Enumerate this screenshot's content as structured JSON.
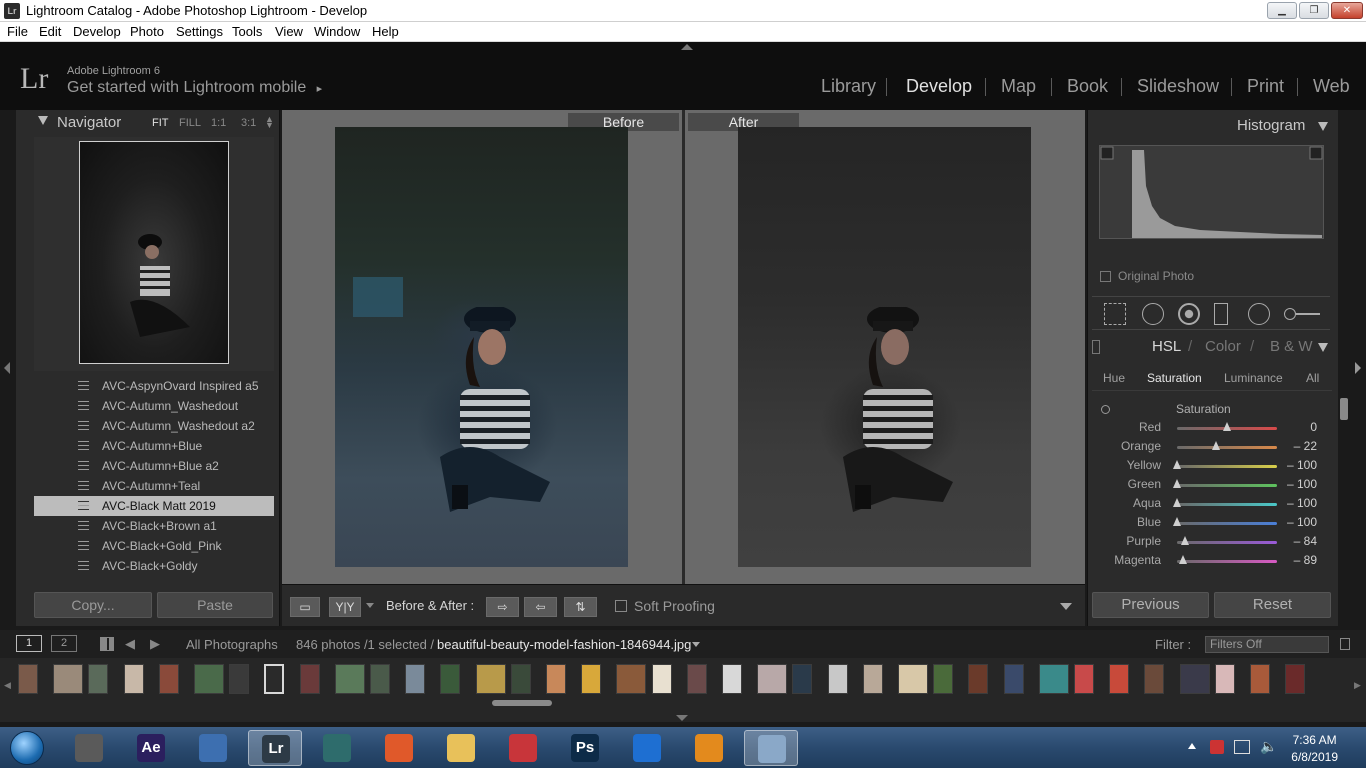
{
  "window": {
    "title": "Lightroom Catalog - Adobe Photoshop Lightroom - Develop",
    "app_icon": "Lr",
    "controls": [
      "minimize-icon",
      "maximize-icon",
      "close-icon"
    ]
  },
  "menu": [
    "File",
    "Edit",
    "Develop",
    "Photo",
    "Settings",
    "Tools",
    "View",
    "Window",
    "Help"
  ],
  "header": {
    "logo": "Lr",
    "version": "Adobe Lightroom 6",
    "mobile_prompt": "Get started with Lightroom mobile",
    "mobile_arrow": "▸",
    "modules": [
      "Library",
      "Develop",
      "Map",
      "Book",
      "Slideshow",
      "Print",
      "Web"
    ],
    "active_module": "Develop"
  },
  "navigator": {
    "title": "Navigator",
    "zoom_options": [
      "FIT",
      "FILL",
      "1:1",
      "3:1"
    ],
    "active_zoom": "FIT"
  },
  "presets": {
    "items": [
      "AVC-AspynOvard Inspired a5",
      "AVC-Autumn_Washedout",
      "AVC-Autumn_Washedout a2",
      "AVC-Autumn+Blue",
      "AVC-Autumn+Blue a2",
      "AVC-Autumn+Teal",
      "AVC-Black Matt 2019",
      "AVC-Black+Brown a1",
      "AVC-Black+Gold_Pink",
      "AVC-Black+Goldy"
    ],
    "selected": "AVC-Black Matt 2019"
  },
  "left_buttons": {
    "copy": "Copy...",
    "paste": "Paste"
  },
  "compare": {
    "before": "Before",
    "after": "After"
  },
  "toolbar": {
    "yy_label": "Y|Y",
    "mode_label": "Before & After :",
    "soft_proofing": "Soft Proofing"
  },
  "histogram": {
    "title": "Histogram",
    "original_photo": "Original Photo"
  },
  "hsl": {
    "tabs_header": [
      "HSL",
      "Color",
      "B & W"
    ],
    "subtabs": [
      "Hue",
      "Saturation",
      "Luminance",
      "All"
    ],
    "active_subtab": "Saturation",
    "section": "Saturation",
    "sliders": [
      {
        "name": "Red",
        "value": 0,
        "display": "0",
        "color": "#d84a4a"
      },
      {
        "name": "Orange",
        "value": -22,
        "display": "– 22",
        "color": "#d8894a"
      },
      {
        "name": "Yellow",
        "value": -100,
        "display": "– 100",
        "color": "#d8cf4a"
      },
      {
        "name": "Green",
        "value": -100,
        "display": "– 100",
        "color": "#5ec25e"
      },
      {
        "name": "Aqua",
        "value": -100,
        "display": "– 100",
        "color": "#4ac8c8"
      },
      {
        "name": "Blue",
        "value": -100,
        "display": "– 100",
        "color": "#4a7fd8"
      },
      {
        "name": "Purple",
        "value": -84,
        "display": "– 84",
        "color": "#9a5ad8"
      },
      {
        "name": "Magenta",
        "value": -89,
        "display": "– 89",
        "color": "#d85ac4"
      }
    ]
  },
  "right_buttons": {
    "previous": "Previous",
    "reset": "Reset"
  },
  "filmstrip_bar": {
    "page1": "1",
    "page2": "2",
    "source": "All Photographs",
    "count": "846 photos /1 selected /",
    "filename": "beautiful-beauty-model-fashion-1846944.jpg",
    "filter_label": "Filter :",
    "filter_value": "Filters Off"
  },
  "taskbar": {
    "time": "7:36 AM",
    "date": "6/8/2019",
    "apps": [
      {
        "name": "film-app",
        "label": "",
        "color": "#5a5a5a"
      },
      {
        "name": "after-effects-app",
        "label": "Ae",
        "color": "#2b1f5e"
      },
      {
        "name": "network-app",
        "label": "",
        "color": "#3d6fb0"
      },
      {
        "name": "lightroom-app",
        "label": "Lr",
        "color": "#2d3a46"
      },
      {
        "name": "filmora-app",
        "label": "",
        "color": "#2e6c6c"
      },
      {
        "name": "firefox-app",
        "label": "",
        "color": "#e0592a"
      },
      {
        "name": "explorer-app",
        "label": "",
        "color": "#e8c15a"
      },
      {
        "name": "recorder-app",
        "label": "",
        "color": "#c8353a"
      },
      {
        "name": "photoshop-app",
        "label": "Ps",
        "color": "#0d2b48"
      },
      {
        "name": "teamviewer-app",
        "label": "",
        "color": "#1e6fd2"
      },
      {
        "name": "audio-app",
        "label": "",
        "color": "#e38a1d"
      },
      {
        "name": "paint-app",
        "label": "",
        "color": "#8aa8c8"
      }
    ]
  }
}
